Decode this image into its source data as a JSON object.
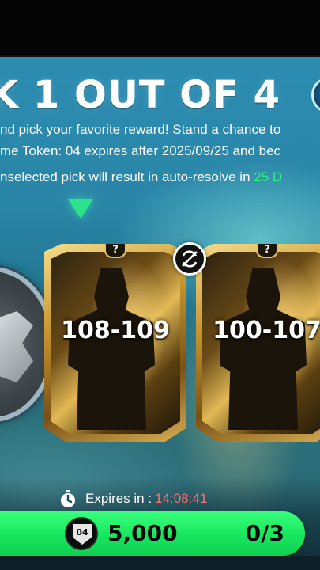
{
  "header": {
    "title": "K 1 OUT OF 4"
  },
  "description": {
    "line1": "nd pick your favorite reward! Stand a chance to",
    "line2": "me Token: 04 expires after 2025/09/25 and bec",
    "line3_prefix": "nselected pick will result in auto-resolve in ",
    "line3_highlight": "25 D"
  },
  "cards": [
    {
      "rating": "108-109",
      "badge": "?"
    },
    {
      "rating": "100-107",
      "badge": "?"
    }
  ],
  "footer": {
    "expires_label": "Expires in :",
    "expires_time": "14:08:41",
    "token_label": "04",
    "price": "5,000",
    "counter": "0/3"
  },
  "colors": {
    "accent_green": "#1ee864",
    "timer_red": "#ff7070",
    "highlight_green": "#2ff37a"
  },
  "icons": [
    "down-arrow-icon",
    "swap-disabled-icon",
    "stopwatch-icon",
    "token-icon"
  ]
}
